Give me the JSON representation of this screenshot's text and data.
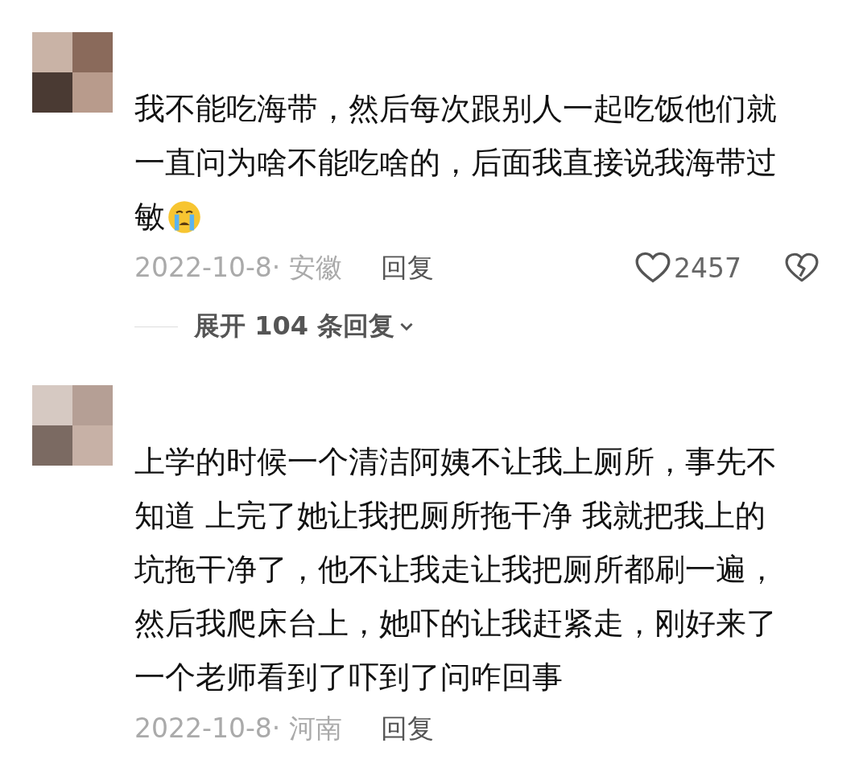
{
  "comments": [
    {
      "lines": [
        "我不能吃海带，然后每次跟别人一起吃饭他们就",
        "一直问为啥不能吃啥的，后面我直接说我海带过",
        "敏"
      ],
      "has_emoji": true,
      "meta": "2022-10-8· 安徽",
      "reply_label": "回复",
      "likes": "2457",
      "expand": "展开 **104** 条回复"
    },
    {
      "lines": [
        "上学的时候一个清洁阿姨不让我上厕所，事先不",
        "知道 上完了她让我把厕所拖干净 我就把我上的",
        "坑拖干净了，他不让我走让我把厕所都刷一遍，",
        "然后我爬床台上，她吓的让我赶紧走，刚好来了",
        "一个老师看到了吓到了问咋回事"
      ],
      "has_emoji": false,
      "meta": "2022-10-8· 河南",
      "reply_label": "回复"
    }
  ]
}
